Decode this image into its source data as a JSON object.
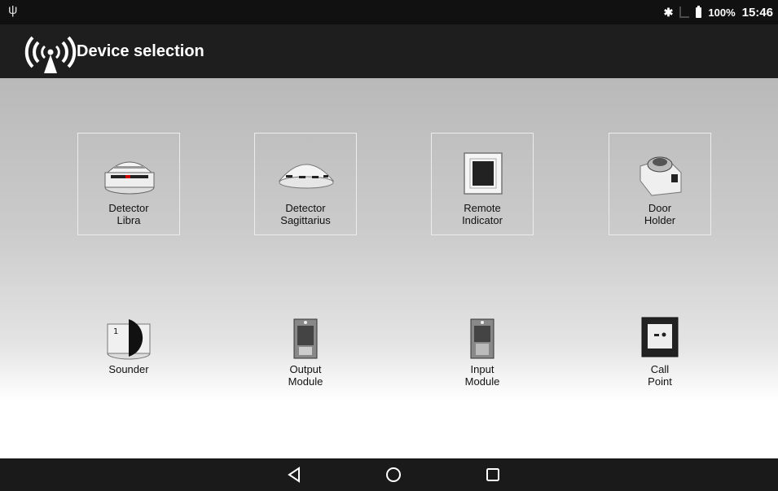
{
  "status_bar": {
    "usb_icon": "usb-icon",
    "bluetooth_icon": "bluetooth-icon",
    "battery_percent": "100%",
    "time": "15:46"
  },
  "app_bar": {
    "icon": "wireless-signal-icon",
    "title": "Device selection"
  },
  "devices": [
    {
      "line1": "Detector",
      "line2": "Libra",
      "icon": "detector-libra-icon"
    },
    {
      "line1": "Detector",
      "line2": "Sagittarius",
      "icon": "detector-sagittarius-icon"
    },
    {
      "line1": "Remote",
      "line2": "Indicator",
      "icon": "remote-indicator-icon"
    },
    {
      "line1": "Door",
      "line2": "Holder",
      "icon": "door-holder-icon"
    },
    {
      "line1": "Sounder",
      "line2": "",
      "icon": "sounder-icon"
    },
    {
      "line1": "Output",
      "line2": "Module",
      "icon": "output-module-icon"
    },
    {
      "line1": "Input",
      "line2": "Module",
      "icon": "input-module-icon"
    },
    {
      "line1": "Call",
      "line2": "Point",
      "icon": "call-point-icon"
    }
  ],
  "nav_bar": {
    "back_icon": "back-icon",
    "home_icon": "home-icon",
    "recent_icon": "recent-apps-icon"
  },
  "colors": {
    "status_bar": "#111111",
    "app_bar": "#1e1e1e",
    "nav_bar": "#1a1a1a"
  }
}
